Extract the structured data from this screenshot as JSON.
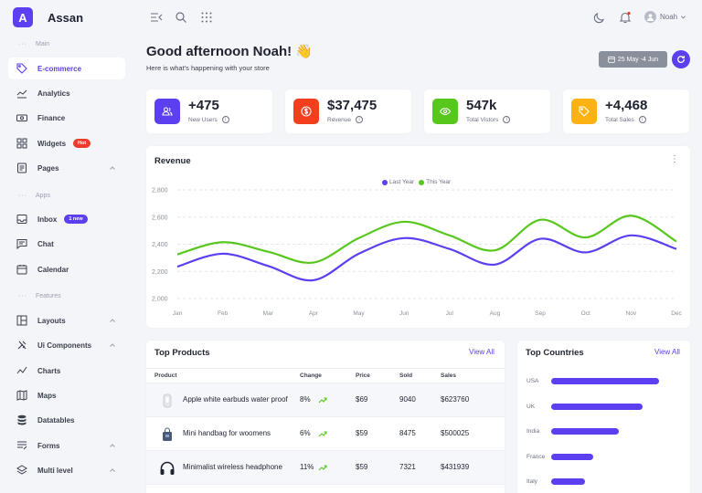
{
  "brand": {
    "logo_letter": "A",
    "name": "Assan",
    "accent": "#5b3ff0"
  },
  "sidebar": {
    "sections": [
      "Main",
      "Apps",
      "Features"
    ],
    "items": [
      {
        "label": "E-commerce",
        "icon": "tag-icon",
        "active": true
      },
      {
        "label": "Analytics",
        "icon": "chart-line-icon"
      },
      {
        "label": "Finance",
        "icon": "cash-icon"
      },
      {
        "label": "Widgets",
        "icon": "grid-icon",
        "badge": "Hot"
      },
      {
        "label": "Pages",
        "icon": "file-icon"
      },
      {
        "label": "Inbox",
        "icon": "inbox-icon",
        "badge": "1 new"
      },
      {
        "label": "Chat",
        "icon": "chat-icon"
      },
      {
        "label": "Calendar",
        "icon": "calendar-icon"
      },
      {
        "label": "Layouts",
        "icon": "layout-icon"
      },
      {
        "label": "Ui Components",
        "icon": "tools-icon"
      },
      {
        "label": "Charts",
        "icon": "chart-icon"
      },
      {
        "label": "Maps",
        "icon": "map-icon"
      },
      {
        "label": "Datatables",
        "icon": "database-icon"
      },
      {
        "label": "Forms",
        "icon": "form-icon"
      },
      {
        "label": "Multi level",
        "icon": "layers-icon"
      }
    ]
  },
  "topbar": {
    "user_name": "Noah"
  },
  "header": {
    "greeting": "Good afternoon Noah! 👋",
    "subtitle": "Here is what's happening with your store",
    "date_range": "25 May -4 Jun"
  },
  "stats": [
    {
      "value": "+475",
      "label": "New Users",
      "color": "#5b3ff0",
      "icon": "users-icon"
    },
    {
      "value": "$37,475",
      "label": "Revenue",
      "color": "#f43f1f",
      "icon": "dollar-icon"
    },
    {
      "value": "547k",
      "label": "Total Vistors",
      "color": "#58c71d",
      "icon": "eye-icon"
    },
    {
      "value": "+4,468",
      "label": "Total Sales",
      "color": "#fbb313",
      "icon": "tag-icon"
    }
  ],
  "revenue": {
    "title": "Revenue"
  },
  "chart_data": {
    "type": "line",
    "title": "Revenue",
    "categories": [
      "Jan",
      "Feb",
      "Mar",
      "Apr",
      "May",
      "Jun",
      "Jul",
      "Aug",
      "Sep",
      "Oct",
      "Nov",
      "Dec"
    ],
    "y_ticks": [
      "2,800",
      "2,600",
      "2,400",
      "2,200",
      "2,000"
    ],
    "ylim": [
      2000,
      2800
    ],
    "grid": true,
    "legend": "top-center",
    "series": [
      {
        "name": "Last Year",
        "color": "#5b3ff0",
        "values": [
          2235,
          2330,
          2240,
          2135,
          2330,
          2445,
          2365,
          2250,
          2440,
          2340,
          2465,
          2365
        ]
      },
      {
        "name": "This Year",
        "color": "#58c71d",
        "values": [
          2325,
          2415,
          2345,
          2265,
          2445,
          2565,
          2465,
          2355,
          2580,
          2450,
          2610,
          2420
        ]
      }
    ]
  },
  "products": {
    "title": "Top Products",
    "view_all": "View All",
    "columns": [
      "Product",
      "Change",
      "Price",
      "Sold",
      "Sales"
    ],
    "rows": [
      {
        "name": "Apple white earbuds water proof",
        "change": "8%",
        "price": "$69",
        "sold": "9040",
        "sales": "$623760",
        "icon": "earbuds-icon"
      },
      {
        "name": "Mini handbag for woomens",
        "change": "6%",
        "price": "$59",
        "sold": "8475",
        "sales": "$500025",
        "icon": "handbag-icon"
      },
      {
        "name": "Minimalist wireless headphone",
        "change": "11%",
        "price": "$59",
        "sold": "7321",
        "sales": "$431939",
        "icon": "headphone-icon"
      }
    ]
  },
  "countries": {
    "title": "Top Countries",
    "view_all": "View All",
    "items": [
      {
        "name": "USA",
        "share": 1.0
      },
      {
        "name": "UK",
        "share": 0.85
      },
      {
        "name": "India",
        "share": 0.63
      },
      {
        "name": "France",
        "share": 0.39
      },
      {
        "name": "Italy",
        "share": 0.31
      }
    ]
  }
}
